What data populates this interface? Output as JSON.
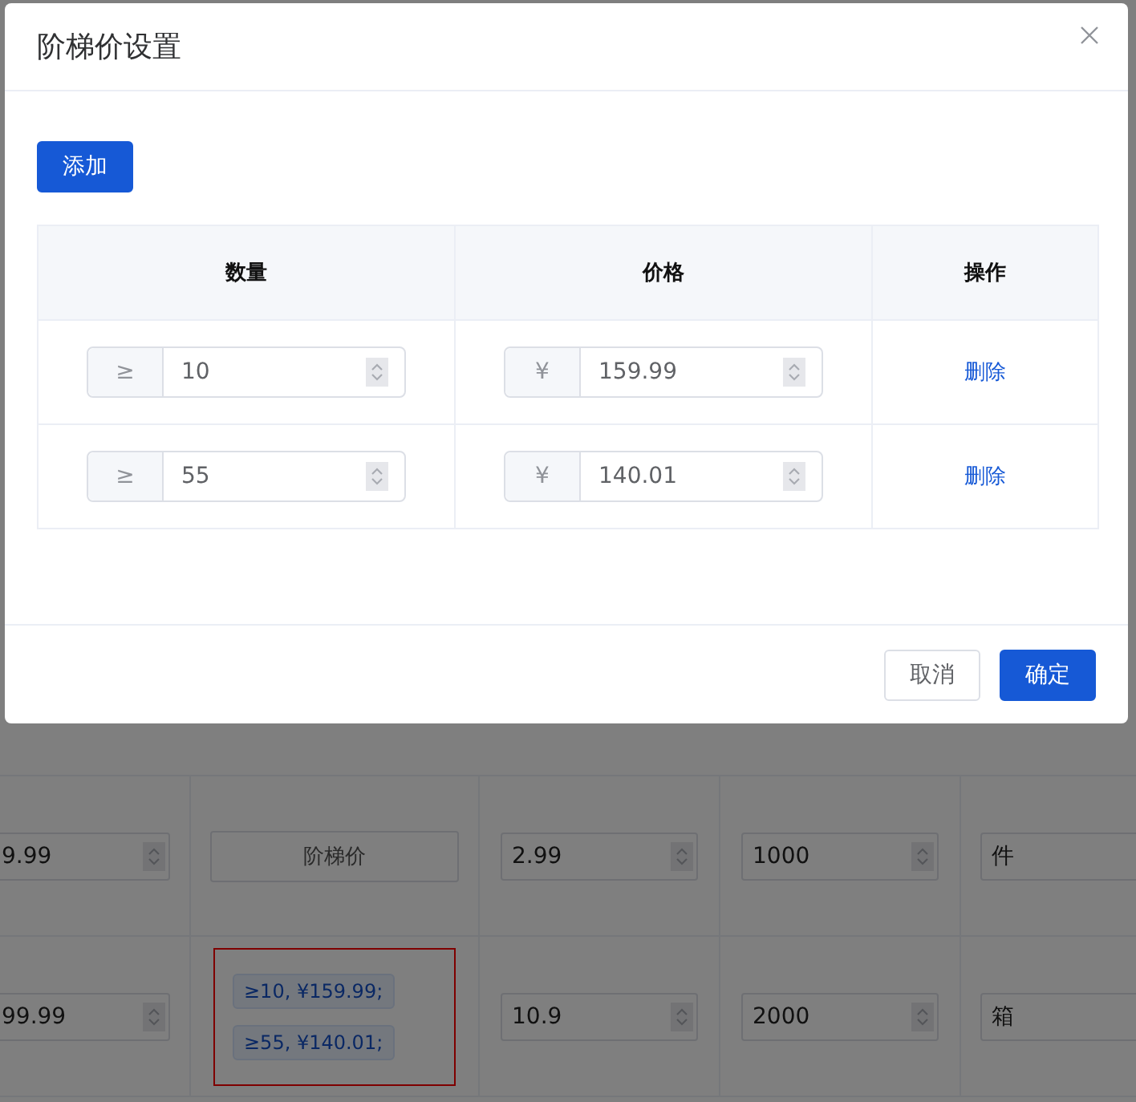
{
  "background_table": {
    "rows": [
      {
        "sale_price": "9.99",
        "tier_price": {
          "kind": "button",
          "label": "阶梯价",
          "highlighted": false
        },
        "tax_rate": "2.99",
        "stock": "1000",
        "unit": "件"
      },
      {
        "sale_price": "99.99",
        "tier_price": {
          "kind": "tags",
          "tags": [
            "≥10, ¥159.99;",
            "≥55, ¥140.01;"
          ],
          "highlighted": true
        },
        "tax_rate": "10.9",
        "stock": "2000",
        "unit": "箱"
      }
    ]
  },
  "dialog": {
    "title": "阶梯价设置",
    "add_button": "添加",
    "table": {
      "columns": [
        "数量",
        "价格",
        "操作"
      ],
      "rows": [
        {
          "quantity_prefix": "≥",
          "quantity": "10",
          "price_prefix": "¥",
          "price": "159.99",
          "action": "删除"
        },
        {
          "quantity_prefix": "≥",
          "quantity": "55",
          "price_prefix": "¥",
          "price": "140.01",
          "action": "删除"
        }
      ]
    },
    "buttons": [
      {
        "label": "取消",
        "kind": "default"
      },
      {
        "label": "确定",
        "kind": "primary"
      }
    ]
  }
}
